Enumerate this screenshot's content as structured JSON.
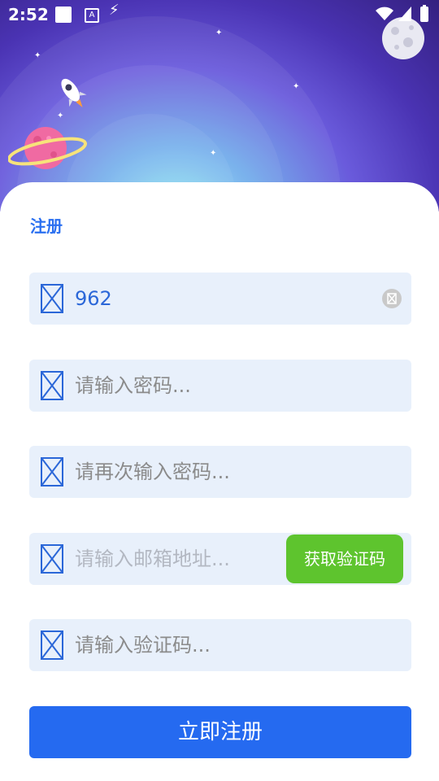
{
  "status_bar": {
    "time": "2:52"
  },
  "form": {
    "title": "注册",
    "fields": [
      {
        "value": "962",
        "placeholder": ""
      },
      {
        "value": "",
        "placeholder": "请输入密码..."
      },
      {
        "value": "",
        "placeholder": "请再次输入密码..."
      },
      {
        "value": "",
        "placeholder": "请输入邮箱地址..."
      },
      {
        "value": "",
        "placeholder": "请输入验证码..."
      }
    ],
    "get_code_label": "获取验证码",
    "submit_label": "立即注册"
  },
  "icons": {
    "field": "broken-image-icon",
    "clear": "clear-icon",
    "planet": "planet-icon",
    "rocket": "rocket-icon",
    "moon": "moon-icon"
  },
  "colors": {
    "accent": "#2a6ff0",
    "button": "#256af0",
    "code_button": "#5ec42e",
    "field_bg": "#e8f0fb"
  }
}
